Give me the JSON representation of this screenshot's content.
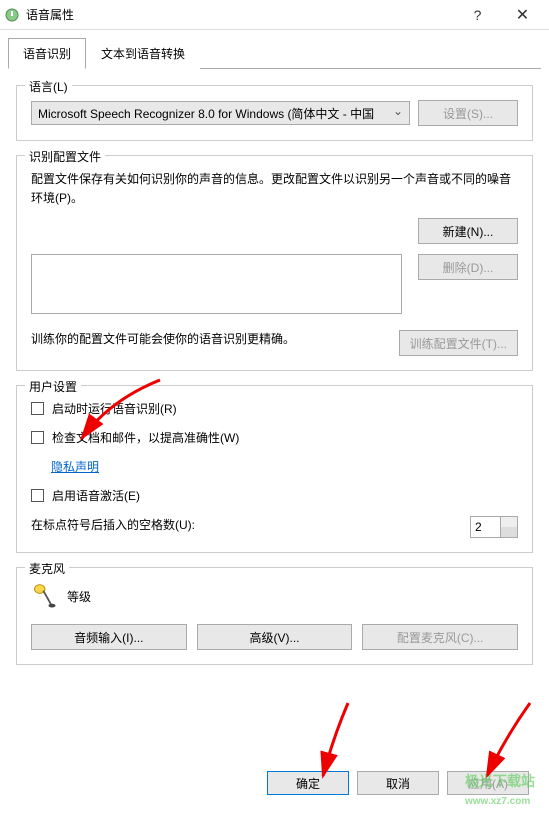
{
  "titlebar": {
    "title": "语音属性"
  },
  "tabs": {
    "recognition": "语音识别",
    "tts": "文本到语音转换"
  },
  "language": {
    "legend": "语言(L)",
    "selected": "Microsoft Speech Recognizer 8.0 for Windows (简体中文 - 中国",
    "settings_btn": "设置(S)..."
  },
  "profile": {
    "legend": "识别配置文件",
    "desc": "配置文件保存有关如何识别你的声音的信息。更改配置文件以识别另一个声音或不同的噪音环境(P)。",
    "new_btn": "新建(N)...",
    "delete_btn": "删除(D)...",
    "train_desc": "训练你的配置文件可能会使你的语音识别更精确。",
    "train_btn": "训练配置文件(T)..."
  },
  "user_settings": {
    "legend": "用户设置",
    "run_on_start": "启动时运行语音识别(R)",
    "check_docs": "检查文档和邮件，以提高准确性(W)",
    "privacy": "隐私声明",
    "enable_voice": "启用语音激活(E)",
    "spaces_label": "在标点符号后插入的空格数(U):",
    "spaces_value": "2"
  },
  "microphone": {
    "legend": "麦克风",
    "level": "等级",
    "audio_input_btn": "音频输入(I)...",
    "advanced_btn": "高级(V)...",
    "config_mic_btn": "配置麦克风(C)..."
  },
  "footer": {
    "ok": "确定",
    "cancel": "取消",
    "apply": "应用(A)"
  },
  "watermark": "极光下载站\nwww.xz7.com"
}
